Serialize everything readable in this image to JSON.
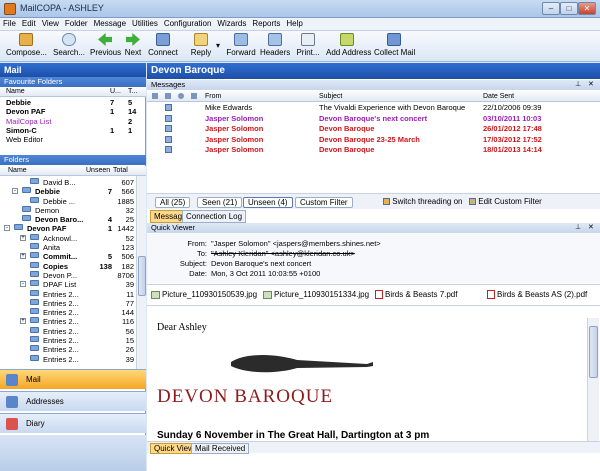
{
  "window": {
    "title": "MailCOPA - ASHLEY"
  },
  "menu": [
    "File",
    "Edit",
    "View",
    "Folder",
    "Message",
    "Utilities",
    "Configuration",
    "Wizards",
    "Reports",
    "Help"
  ],
  "toolbar": {
    "compose": "Compose...",
    "search": "Search...",
    "previous": "Previous",
    "next": "Next",
    "connect": "Connect",
    "reply": "Reply",
    "forward": "Forward",
    "headers": "Headers",
    "print": "Print...",
    "add_address": "Add Address",
    "collect_mail": "Collect Mail"
  },
  "left": {
    "title": "Mail",
    "favourites_title": "Favourite Folders",
    "fav_cols": {
      "name": "Name",
      "u": "U...",
      "t": "T..."
    },
    "favourites": [
      {
        "name": "Debbie",
        "u": "7",
        "t": "5",
        "style": "bold"
      },
      {
        "name": "Devon PAF",
        "u": "1",
        "t": "14",
        "style": "bold"
      },
      {
        "name": "MailCopa List",
        "u": "",
        "t": "2",
        "style": "purple"
      },
      {
        "name": "Simon-C",
        "u": "1",
        "t": "1",
        "style": "bold"
      },
      {
        "name": "Web Editor",
        "u": "",
        "t": "",
        "style": ""
      }
    ],
    "folders_title": "Folders",
    "folder_cols": {
      "name": "Name",
      "unseen": "Unseen",
      "total": "Total"
    },
    "folders": [
      {
        "name": "David B...",
        "unseen": "",
        "total": "607",
        "indent": 3,
        "exp": "",
        "style": ""
      },
      {
        "name": "Debbie",
        "unseen": "7",
        "total": "566",
        "indent": 2,
        "exp": "-",
        "style": "bold"
      },
      {
        "name": "Debbie ...",
        "unseen": "",
        "total": "1885",
        "indent": 3,
        "exp": "",
        "style": ""
      },
      {
        "name": "Demon",
        "unseen": "",
        "total": "32",
        "indent": 2,
        "exp": "",
        "style": ""
      },
      {
        "name": "Devon Baro...",
        "unseen": "4",
        "total": "25",
        "indent": 2,
        "exp": "",
        "style": "bold"
      },
      {
        "name": "Devon PAF",
        "unseen": "1",
        "total": "1442",
        "indent": 1,
        "exp": "-",
        "style": "bold"
      },
      {
        "name": "Acknowl...",
        "unseen": "",
        "total": "52",
        "indent": 3,
        "exp": "+",
        "style": ""
      },
      {
        "name": "Anita",
        "unseen": "",
        "total": "123",
        "indent": 3,
        "exp": "",
        "style": ""
      },
      {
        "name": "Commit...",
        "unseen": "5",
        "total": "506",
        "indent": 3,
        "exp": "+",
        "style": "bold"
      },
      {
        "name": "Copies",
        "unseen": "138",
        "total": "182",
        "indent": 3,
        "exp": "",
        "style": "bold"
      },
      {
        "name": "Devon P...",
        "unseen": "",
        "total": "8706",
        "indent": 3,
        "exp": "",
        "style": ""
      },
      {
        "name": "DPAF List",
        "unseen": "",
        "total": "39",
        "indent": 3,
        "exp": "-",
        "style": ""
      },
      {
        "name": "Entries 2...",
        "unseen": "",
        "total": "11",
        "indent": 3,
        "exp": "",
        "style": ""
      },
      {
        "name": "Entries 2...",
        "unseen": "",
        "total": "77",
        "indent": 3,
        "exp": "",
        "style": ""
      },
      {
        "name": "Entries 2...",
        "unseen": "",
        "total": "144",
        "indent": 3,
        "exp": "",
        "style": ""
      },
      {
        "name": "Entries 2...",
        "unseen": "",
        "total": "116",
        "indent": 3,
        "exp": "+",
        "style": ""
      },
      {
        "name": "Entries 2...",
        "unseen": "",
        "total": "56",
        "indent": 3,
        "exp": "",
        "style": ""
      },
      {
        "name": "Entries 2...",
        "unseen": "",
        "total": "15",
        "indent": 3,
        "exp": "",
        "style": ""
      },
      {
        "name": "Entries 2...",
        "unseen": "",
        "total": "26",
        "indent": 3,
        "exp": "",
        "style": ""
      },
      {
        "name": "Entries 2...",
        "unseen": "",
        "total": "39",
        "indent": 3,
        "exp": "",
        "style": ""
      }
    ],
    "nav": {
      "mail": "Mail",
      "addresses": "Addresses",
      "diary": "Diary"
    }
  },
  "right": {
    "folder_title": "Devon Baroque",
    "messages_title": "Messages",
    "cols": {
      "from": "From",
      "subject": "Subject",
      "date": "Date Sent"
    },
    "messages": [
      {
        "from": "Mike Edwards",
        "subject": "The Vivaldi Experience with Devon Baroque",
        "date": "22/10/2006 09:39",
        "style": ""
      },
      {
        "from": "Jasper Solomon",
        "subject": "Devon Baroque's next concert",
        "date": "03/10/2011 10:03",
        "style": "purple"
      },
      {
        "from": "Jasper Solomon",
        "subject": "Devon Baroque",
        "date": "26/01/2012 17:48",
        "style": "red"
      },
      {
        "from": "Jasper Solomon",
        "subject": "Devon Baroque 23-25 March",
        "date": "17/03/2012 17:52",
        "style": "red"
      },
      {
        "from": "Jasper Solomon",
        "subject": "Devon Baroque",
        "date": "18/01/2013 14:14",
        "style": "red"
      }
    ],
    "filters": {
      "all": "All (25)",
      "seen": "Seen (21)",
      "unseen": "Unseen (4)",
      "custom": "Custom Filter"
    },
    "switch_threading": "Switch threading on",
    "edit_custom_filter": "Edit Custom Filter",
    "tabs": {
      "messages": "Messages",
      "connection_log": "Connection Log"
    },
    "viewer_title": "Quick Viewer",
    "headers": {
      "from_label": "From:",
      "from": "\"Jasper Solomon\" <jaspers@members.shines.net>",
      "to_label": "To:",
      "to": "\"Ashley Kleridan\" <ashley@kleridan.co.uk>",
      "subject_label": "Subject:",
      "subject": "Devon Baroque's next concert",
      "date_label": "Date:",
      "date": "Mon, 3 Oct 2011 10:03:55 +0100"
    },
    "attachments": [
      "Picture_110930150539.jpg",
      "Picture_110930151334.jpg",
      "Birds & Beasts 7.pdf",
      "Birds & Beasts AS (2).pdf"
    ],
    "body": {
      "greeting": "Dear Ashley",
      "banner": "DEVON BAROQUE",
      "cutoff": "Sunday 6 November in The Great Hall, Dartington at 3 pm"
    },
    "bottom_tabs": {
      "quick_viewer": "Quick Viewer",
      "mail_received": "Mail Received"
    }
  }
}
